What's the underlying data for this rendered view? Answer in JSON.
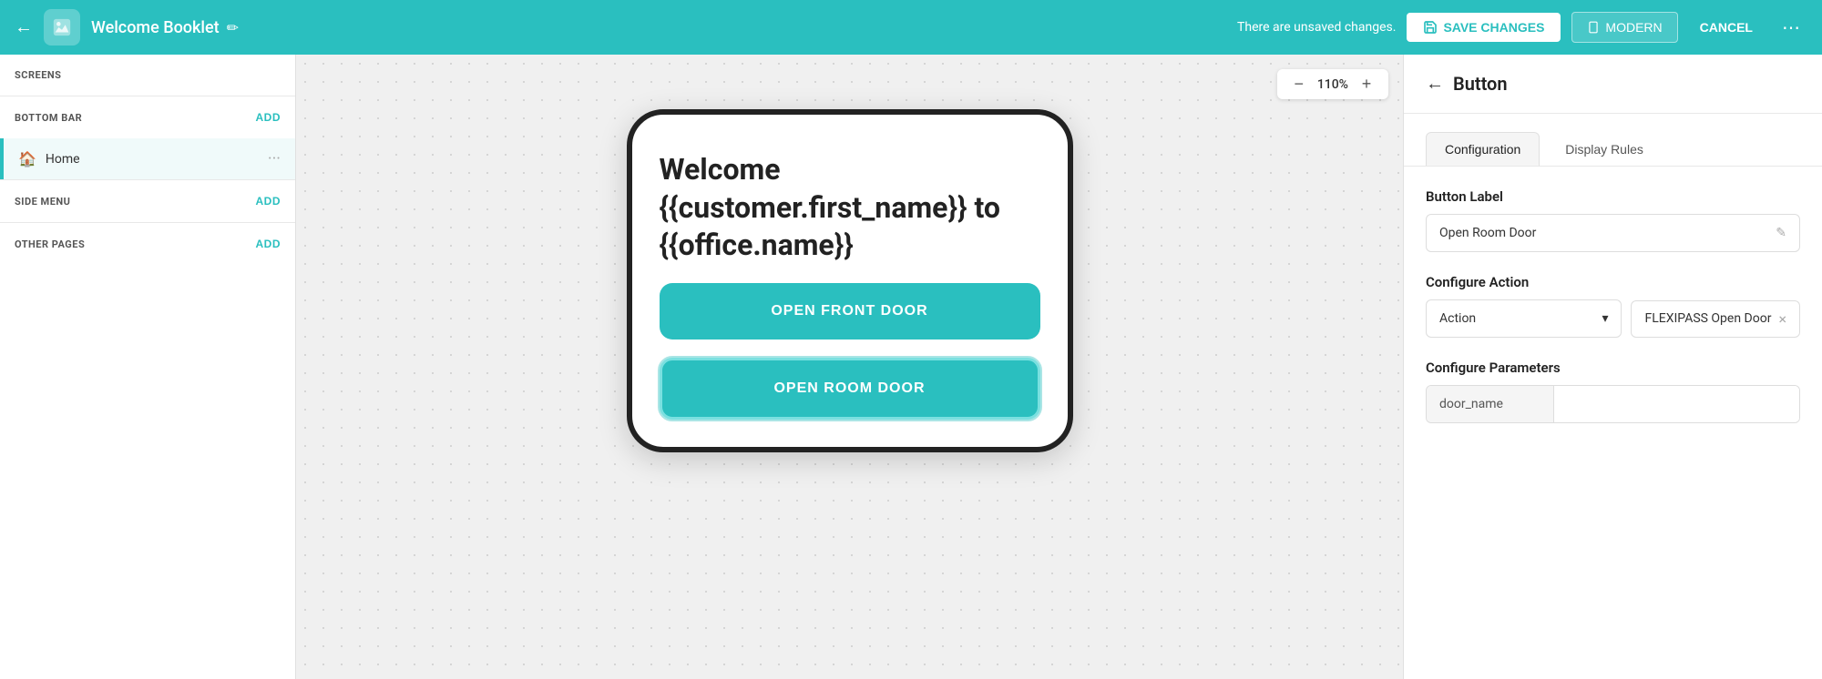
{
  "topbar": {
    "back_icon": "←",
    "app_icon": "🖼",
    "title": "Welcome Booklet",
    "edit_icon": "✏",
    "unsaved_message": "There are unsaved changes.",
    "save_label": "SAVE CHANGES",
    "modern_label": "MODERN",
    "cancel_label": "CANCEL",
    "more_icon": "⋯"
  },
  "sidebar": {
    "screens_title": "SCREENS",
    "bottom_bar_title": "BOTTOM BAR",
    "bottom_bar_add": "ADD",
    "home_label": "Home",
    "side_menu_title": "SIDE MENU",
    "side_menu_add": "ADD",
    "other_pages_title": "OTHER PAGES",
    "other_pages_add": "ADD",
    "more_icon": "···"
  },
  "canvas": {
    "zoom_level": "110%",
    "zoom_minus": "−",
    "zoom_plus": "+",
    "welcome_text": "Welcome {{customer.first_name}} to {{office.name}}",
    "btn_front_door": "OPEN FRONT DOOR",
    "btn_room_door": "OPEN ROOM DOOR"
  },
  "panel": {
    "back_icon": "←",
    "title": "Button",
    "tab_config": "Configuration",
    "tab_display": "Display Rules",
    "button_label_heading": "Button Label",
    "button_label_value": "Open Room Door",
    "edit_icon": "✎",
    "configure_action_heading": "Configure Action",
    "action_placeholder": "Action",
    "action_chevron": "▾",
    "action_value": "FLEXIPASS Open Door",
    "action_close": "×",
    "configure_params_heading": "Configure Parameters",
    "param_key": "door_name",
    "param_value": ""
  }
}
